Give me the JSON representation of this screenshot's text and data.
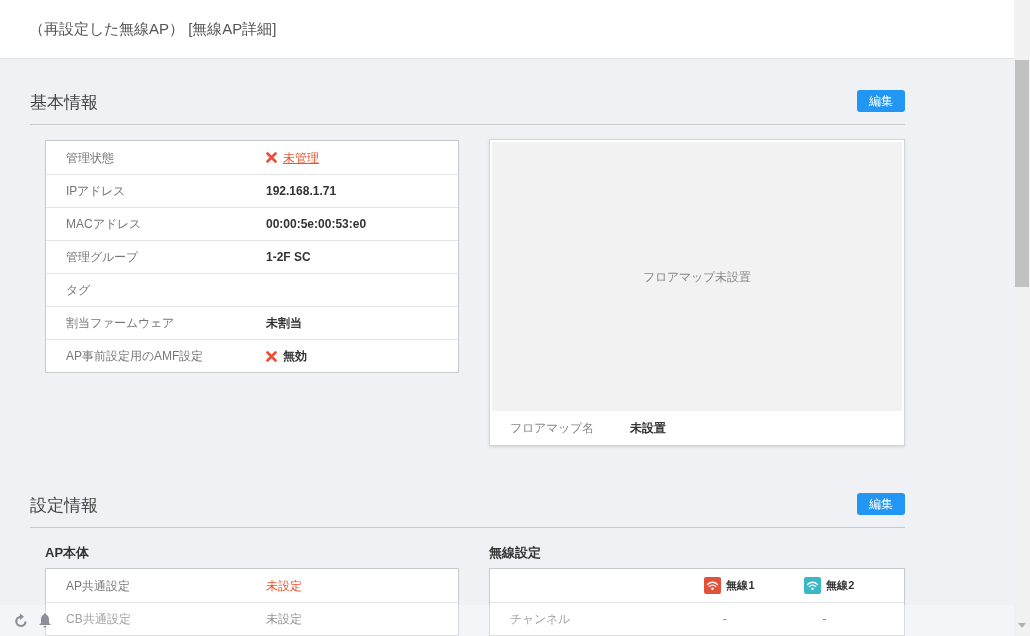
{
  "header": {
    "title": "（再設定した無線AP） [無線AP詳細]"
  },
  "basic": {
    "title": "基本情報",
    "edit_button": "編集",
    "rows": [
      {
        "label": "管理状態",
        "value": "未管理",
        "kind": "alert-link"
      },
      {
        "label": "IPアドレス",
        "value": "192.168.1.71",
        "kind": "plain"
      },
      {
        "label": "MACアドレス",
        "value": "00:00:5e:00:53:e0",
        "kind": "plain"
      },
      {
        "label": "管理グループ",
        "value": "1-2F SC",
        "kind": "plain"
      },
      {
        "label": "タグ"
      },
      {
        "label": "割当ファームウェア",
        "value": "未割当",
        "kind": "plain"
      },
      {
        "label": "AP事前設定用のAMF設定",
        "value": "無効",
        "kind": "crossed"
      }
    ],
    "floor_map": {
      "placeholder_text": "フロアマップ未設置",
      "name_label": "フロアマップ名",
      "name_value": "未設置"
    }
  },
  "settings": {
    "title": "設定情報",
    "edit_button": "編集",
    "ap_body": {
      "title": "AP本体",
      "rows": [
        {
          "label": "AP共通設定",
          "value": "未設定",
          "kind": "alert"
        },
        {
          "label": "CB共通設定",
          "value": "未設定",
          "kind": "muted"
        }
      ]
    },
    "wireless": {
      "title": "無線設定",
      "columns": [
        {
          "label": "無線1",
          "color": "#e0533a"
        },
        {
          "label": "無線2",
          "color": "#3bb8c6"
        }
      ],
      "rows": [
        {
          "label": "チャンネル",
          "values": [
            "-",
            "-"
          ]
        }
      ]
    }
  },
  "footer_toolbar": {
    "buttons": [
      {
        "kind": "refresh"
      },
      {
        "kind": "bell"
      }
    ]
  }
}
